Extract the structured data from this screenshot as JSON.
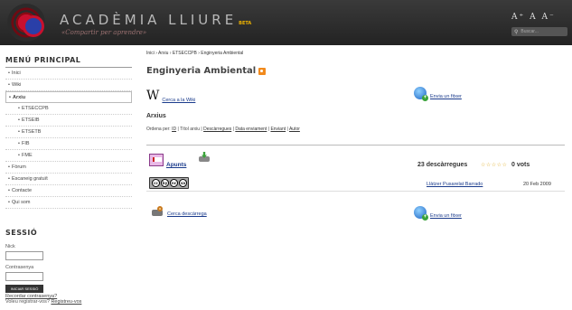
{
  "header": {
    "site_name": "ACADÈMIA LLIURE",
    "beta_label": "BETA",
    "slogan": "«Compartir per aprendre»",
    "font_tools": "A⁺ A A⁻",
    "search_placeholder": "Buscar..."
  },
  "sidebar": {
    "menu_title": "MENÚ PRINCIPAL",
    "items": [
      {
        "label": "Inici"
      },
      {
        "label": "Wiki"
      },
      {
        "label": "Arxiu"
      },
      {
        "label": "ETSECCPB"
      },
      {
        "label": "ETSEIB"
      },
      {
        "label": "ETSETB"
      },
      {
        "label": "FIB"
      },
      {
        "label": "FME"
      },
      {
        "label": "Fòrum"
      },
      {
        "label": "Escaneig gratuït"
      },
      {
        "label": "Contacte"
      },
      {
        "label": "Qui som"
      }
    ],
    "session": {
      "title": "SESSIÓ",
      "nick_label": "Nick",
      "password_label": "Contrasenya",
      "login_button": "INICIAR SESSIÓ",
      "recover_link": "Recordar contrasenya?",
      "register_prompt": "Voleu registrar-vos?",
      "register_link": "Registreu-vos"
    }
  },
  "main": {
    "breadcrumb": "Inici › Arxiu › ETSECCPB › Enginyeria Ambiental",
    "title": "Enginyeria Ambiental",
    "wiki_symbol": "W",
    "wiki_link": "Cerca a la Wiki",
    "upload_link": "Envia un fitxer",
    "section_title": "Arxius",
    "sort": {
      "prefix": "Ordena per:",
      "options": [
        "ID",
        "Títol arxiu",
        "Descàrregues",
        "Data enviament",
        "Enviant",
        "Autor"
      ]
    },
    "resource": {
      "title": "Apunts",
      "downloads": "23 descàrregues",
      "stars": "☆☆☆☆☆",
      "rating_value": 0,
      "votes": "0 vots",
      "license": [
        "cc",
        "by",
        "nc",
        "sa"
      ],
      "author": "Llàtzer Pusarelat Barrado",
      "date": "20 Feb 2009"
    },
    "search_downloads_link": "Cerca descàrrega",
    "upload_link_bottom": "Envia un fitxer"
  }
}
